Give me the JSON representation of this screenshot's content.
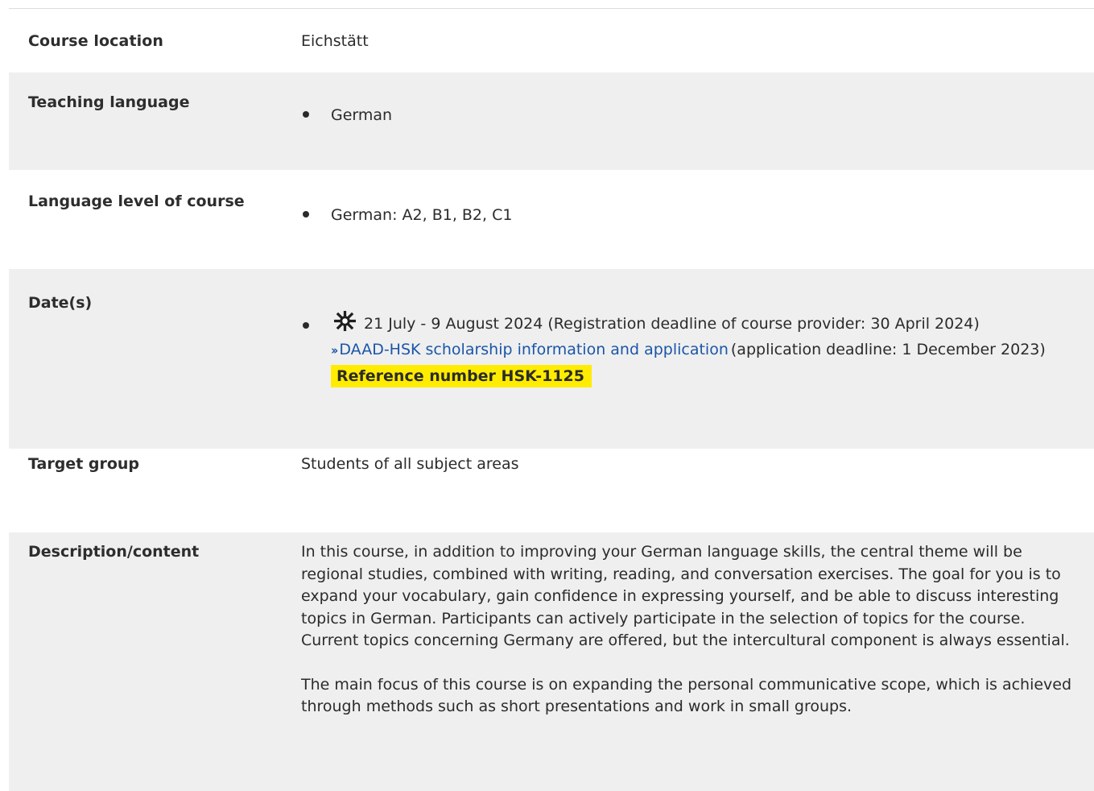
{
  "rows": [
    {
      "label": "Course location",
      "value": "Eichstätt"
    },
    {
      "label": "Teaching language",
      "value": "German"
    },
    {
      "label": "Language level of course",
      "value": "German: A2, B1, B2, C1"
    },
    {
      "label": "Date(s)",
      "season_icon": "sun-icon",
      "dates_text": "21 July - 9 August 2024 (Registration deadline of course provider: 30 April 2024)",
      "link_icon": "double-chevron-right-icon",
      "link_text": "DAAD-HSK scholarship information and application",
      "link_suffix": "(application deadline: 1 December 2023)",
      "reference": "Reference number HSK-1125"
    },
    {
      "label": "Target group",
      "value": "Students of all subject areas"
    },
    {
      "label": "Description/content",
      "paragraphs": [
        "In this course, in addition to improving your German language skills, the central theme will be regional studies, combined with writing, reading, and conversation exercises. The goal for you is to expand your vocabulary, gain confidence in expressing yourself, and be able to discuss interesting topics in German. Participants can actively participate in the selection of topics for the course. Current topics concerning Germany are offered, but the intercultural component is always essential.",
        "The main focus of this course is on expanding the personal communicative scope, which is achieved through methods such as short presentations and work in small groups."
      ]
    }
  ],
  "colors": {
    "row_alt_bg": "#efefef",
    "link": "#1a56a8",
    "highlight": "#ffec00"
  }
}
